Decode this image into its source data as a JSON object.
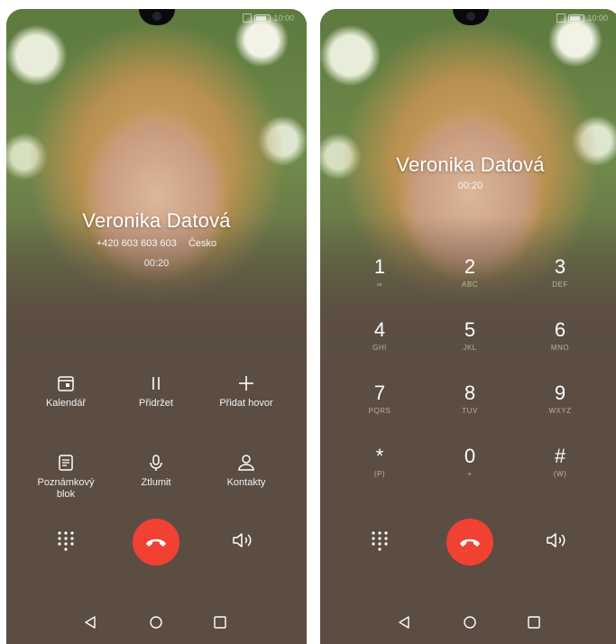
{
  "status": {
    "carrier_left": "",
    "time": "10:00"
  },
  "caller": {
    "name": "Veronika Datová",
    "number": "+420 603 603 603",
    "location": "Česko",
    "duration": "00:20"
  },
  "actions": [
    {
      "id": "calendar",
      "label": "Kalendář",
      "icon": "calendar-icon"
    },
    {
      "id": "hold",
      "label": "Přidržet",
      "icon": "pause-icon"
    },
    {
      "id": "add-call",
      "label": "Přidat hovor",
      "icon": "plus-icon"
    },
    {
      "id": "notepad",
      "label": "Poznámkový blok",
      "icon": "notepad-icon"
    },
    {
      "id": "mute",
      "label": "Ztlumit",
      "icon": "microphone-icon"
    },
    {
      "id": "contacts",
      "label": "Kontakty",
      "icon": "person-icon"
    }
  ],
  "dialpad": [
    {
      "digit": "1",
      "letters": "∞"
    },
    {
      "digit": "2",
      "letters": "ABC"
    },
    {
      "digit": "3",
      "letters": "DEF"
    },
    {
      "digit": "4",
      "letters": "GHI"
    },
    {
      "digit": "5",
      "letters": "JKL"
    },
    {
      "digit": "6",
      "letters": "MNO"
    },
    {
      "digit": "7",
      "letters": "PQRS"
    },
    {
      "digit": "8",
      "letters": "TUV"
    },
    {
      "digit": "9",
      "letters": "WXYZ"
    },
    {
      "digit": "*",
      "letters": "(P)"
    },
    {
      "digit": "0",
      "letters": "+"
    },
    {
      "digit": "#",
      "letters": "(W)"
    }
  ],
  "colors": {
    "end_call": "#f04133",
    "background": "#5b4d42"
  },
  "icons": {
    "keypad": "keypad-icon",
    "end_call": "end-call-icon",
    "speaker": "speaker-icon",
    "back": "back-triangle-icon",
    "home": "home-circle-icon",
    "recents": "recents-square-icon"
  }
}
